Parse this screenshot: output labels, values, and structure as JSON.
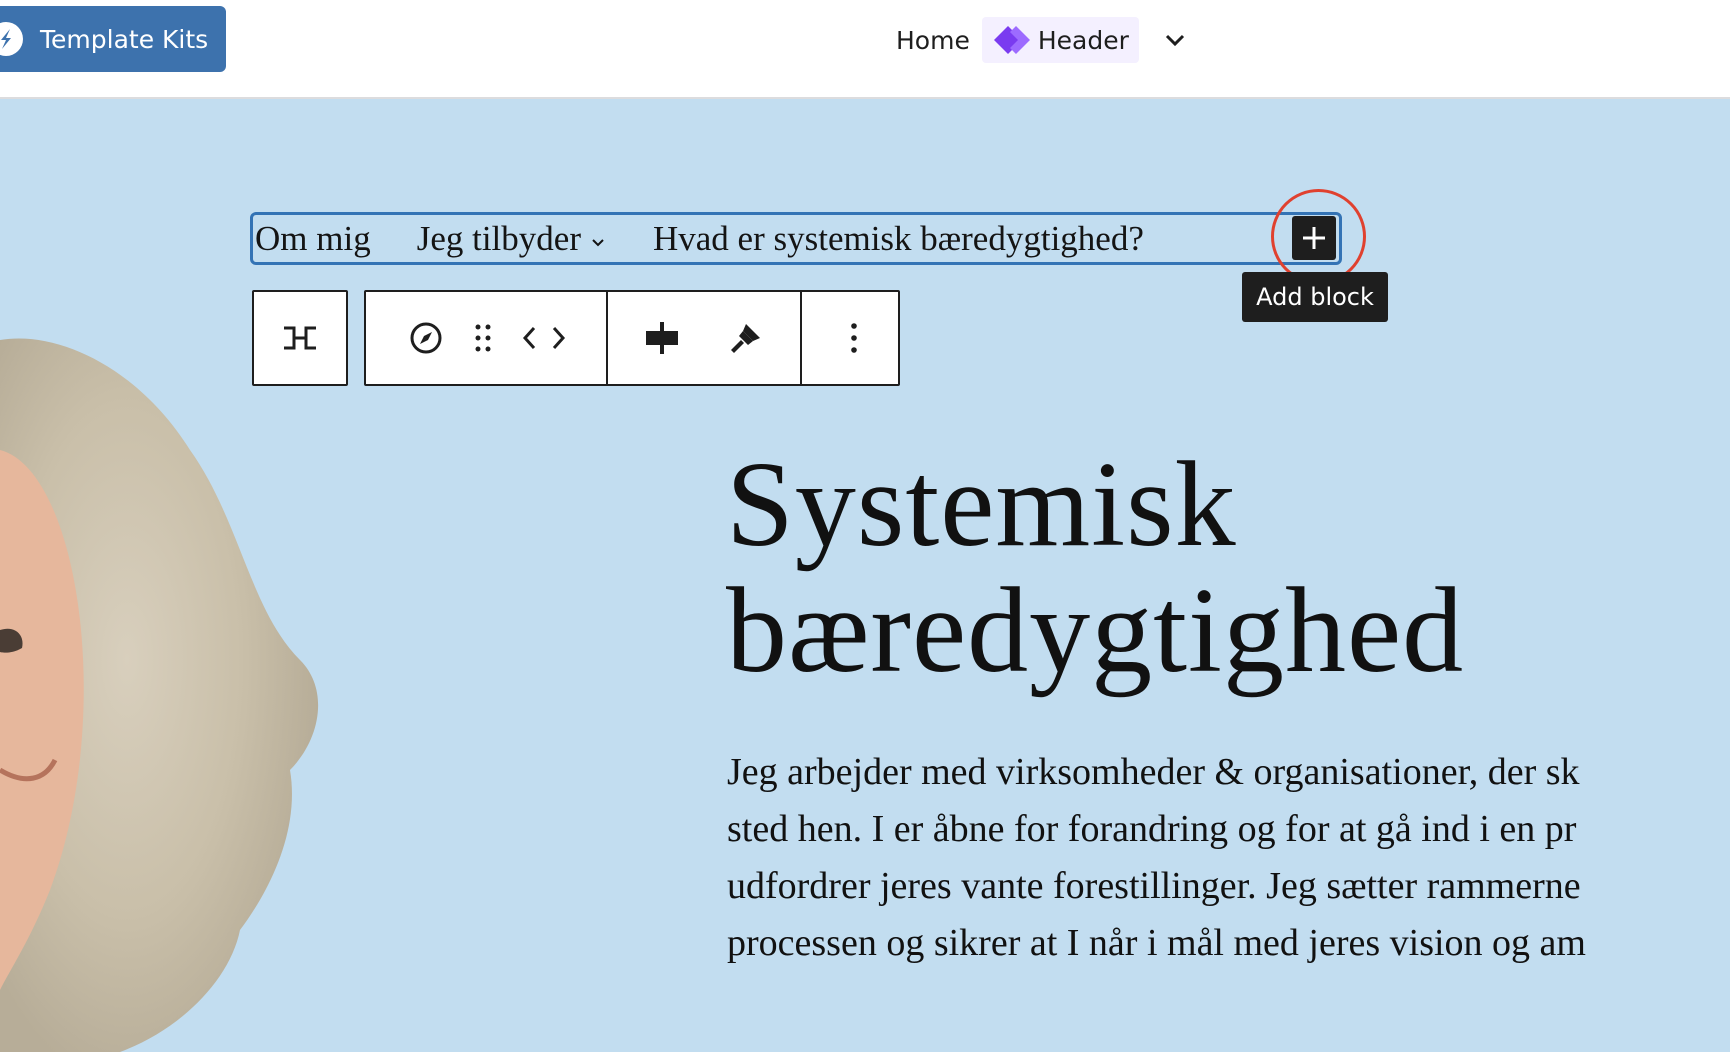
{
  "topbar": {
    "template_kits_label": "Template Kits",
    "breadcrumb_home": "Home",
    "breadcrumb_current": "Header",
    "accent": "#3d72ad"
  },
  "navigation": {
    "items": [
      {
        "label": "Om mig",
        "has_submenu": false
      },
      {
        "label": "Jeg tilbyder",
        "has_submenu": true
      },
      {
        "label": "Hvad er systemisk bæredygtighed?",
        "has_submenu": false
      }
    ],
    "selection_color": "#3373b5"
  },
  "add_block": {
    "tooltip": "Add block",
    "highlight_color": "#e0412f"
  },
  "toolbar": {
    "icons": [
      "transform-icon",
      "compass-icon",
      "drag-handle-icon",
      "move-arrows-icon",
      "justify-icon",
      "style-brush-icon",
      "more-options-icon"
    ]
  },
  "hero": {
    "title_line1": "Systemisk",
    "title_line2": "bæredygtighed",
    "body_lines": [
      "Jeg arbejder med virksomheder & organisationer, der sk",
      "sted hen. I er åbne for forandring og for at gå ind i en pr",
      "udfordrer jeres vante forestillinger. Jeg sætter rammerne",
      "processen og sikrer at I når i mål med jeres vision og am"
    ],
    "background": "#c2ddf0"
  }
}
